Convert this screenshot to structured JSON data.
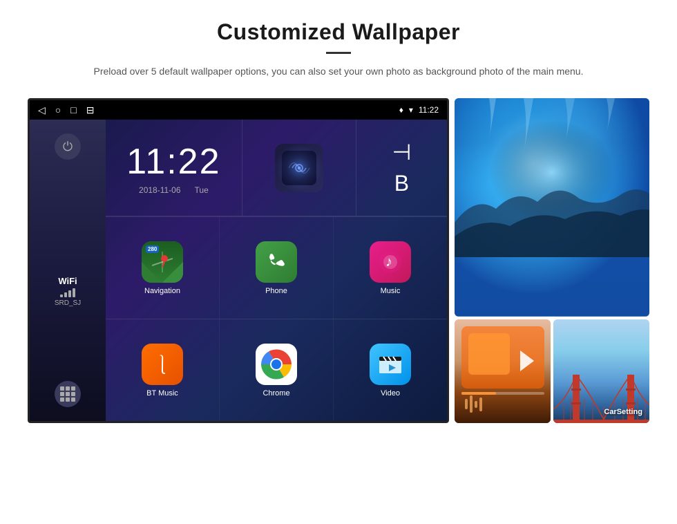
{
  "header": {
    "title": "Customized Wallpaper",
    "description": "Preload over 5 default wallpaper options, you can also set your own photo as background photo of the main menu."
  },
  "device": {
    "status_bar": {
      "time": "11:22",
      "left_icons": [
        "back",
        "home",
        "recent",
        "screenshot"
      ]
    },
    "clock": {
      "time": "11:22",
      "date": "2018-11-06",
      "day": "Tue"
    },
    "wifi": {
      "label": "WiFi",
      "name": "SRD_SJ"
    },
    "apps_row1": [
      {
        "name": "Navigation",
        "icon": "nav"
      },
      {
        "name": "Phone",
        "icon": "phone"
      },
      {
        "name": "Music",
        "icon": "music"
      }
    ],
    "apps_row2": [
      {
        "name": "BT Music",
        "icon": "btmusic"
      },
      {
        "name": "Chrome",
        "icon": "chrome"
      },
      {
        "name": "Video",
        "icon": "video"
      }
    ]
  },
  "wallpapers": {
    "car_setting_label": "CarSetting"
  }
}
